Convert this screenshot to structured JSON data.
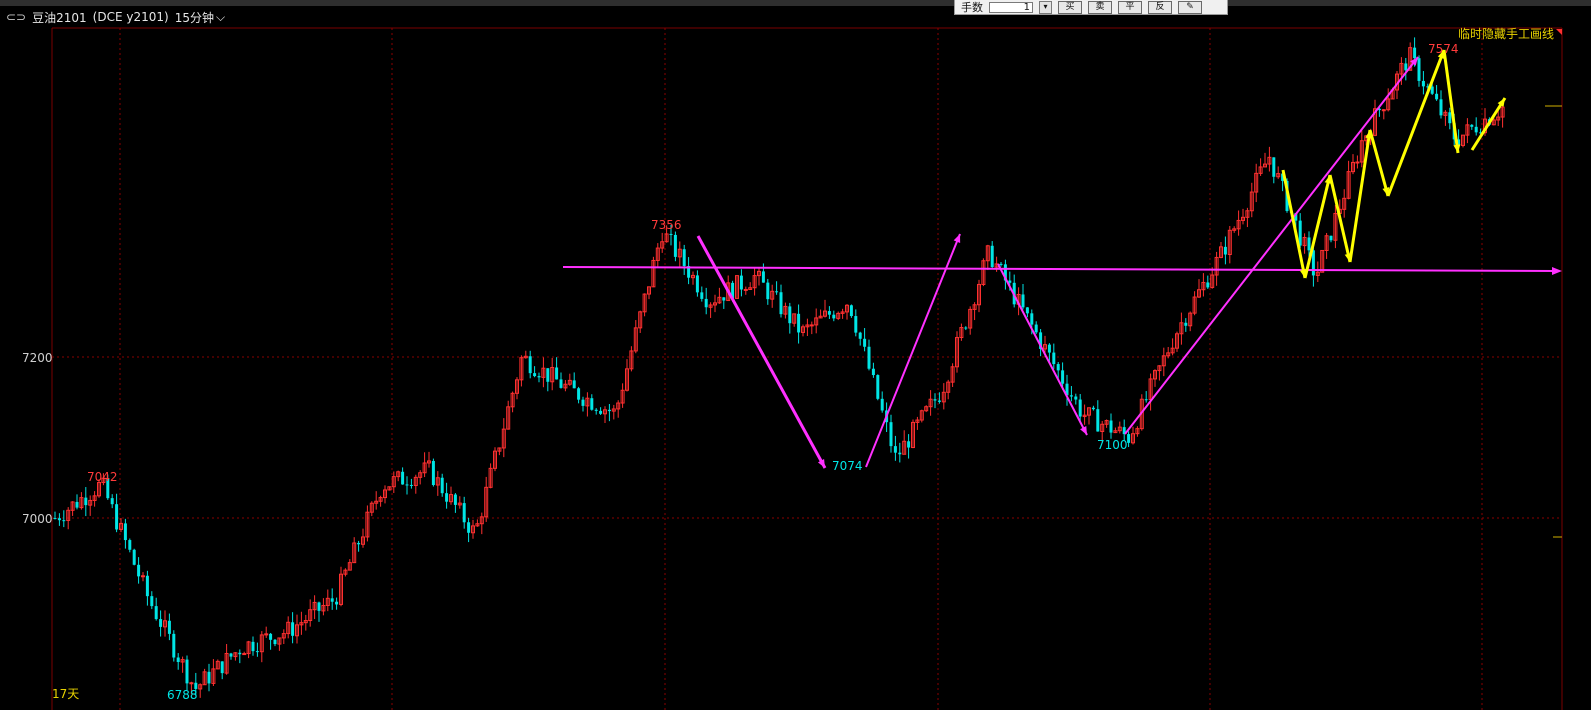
{
  "header": {
    "symbol_icon": "link-icon",
    "contract": "豆油2101",
    "exchange_code": "(DCE y2101)",
    "period": "15分钟",
    "period_icon": "chevron-down-icon"
  },
  "toolbar": {
    "lots_label": "手数",
    "lots_value": "1",
    "buy_label": "买",
    "sell_label": "卖",
    "flat_label": "平",
    "reverse_label": "反",
    "draw_icon": "pencil-icon"
  },
  "chart_labels": {
    "hide_lines": "临时隐藏手工画线",
    "days": "17天"
  },
  "colors": {
    "up": "#ff3030",
    "down": "#00e5e5",
    "grid": "#8a0000",
    "magenta": "#ff30ff",
    "yellow": "#ffff00",
    "label_red": "#ff3b3b",
    "label_cyan": "#00e8e8"
  },
  "chart_data": {
    "type": "candlestick",
    "y_ticks": [
      7200,
      7000
    ],
    "annotations": [
      {
        "text": "7042",
        "kind": "high"
      },
      {
        "text": "6788",
        "kind": "low"
      },
      {
        "text": "7356",
        "kind": "high"
      },
      {
        "text": "7074",
        "kind": "low"
      },
      {
        "text": "7100",
        "kind": "low"
      },
      {
        "text": "7574",
        "kind": "high"
      }
    ],
    "close_path": [
      7000,
      7042,
      6900,
      6788,
      6840,
      6860,
      6900,
      7040,
      7060,
      6980,
      7200,
      7160,
      7130,
      7356,
      7270,
      7300,
      7230,
      7270,
      7074,
      7160,
      7330,
      7230,
      7130,
      7100,
      7230,
      7330,
      7450,
      7300,
      7470,
      7574,
      7470,
      7510
    ]
  }
}
